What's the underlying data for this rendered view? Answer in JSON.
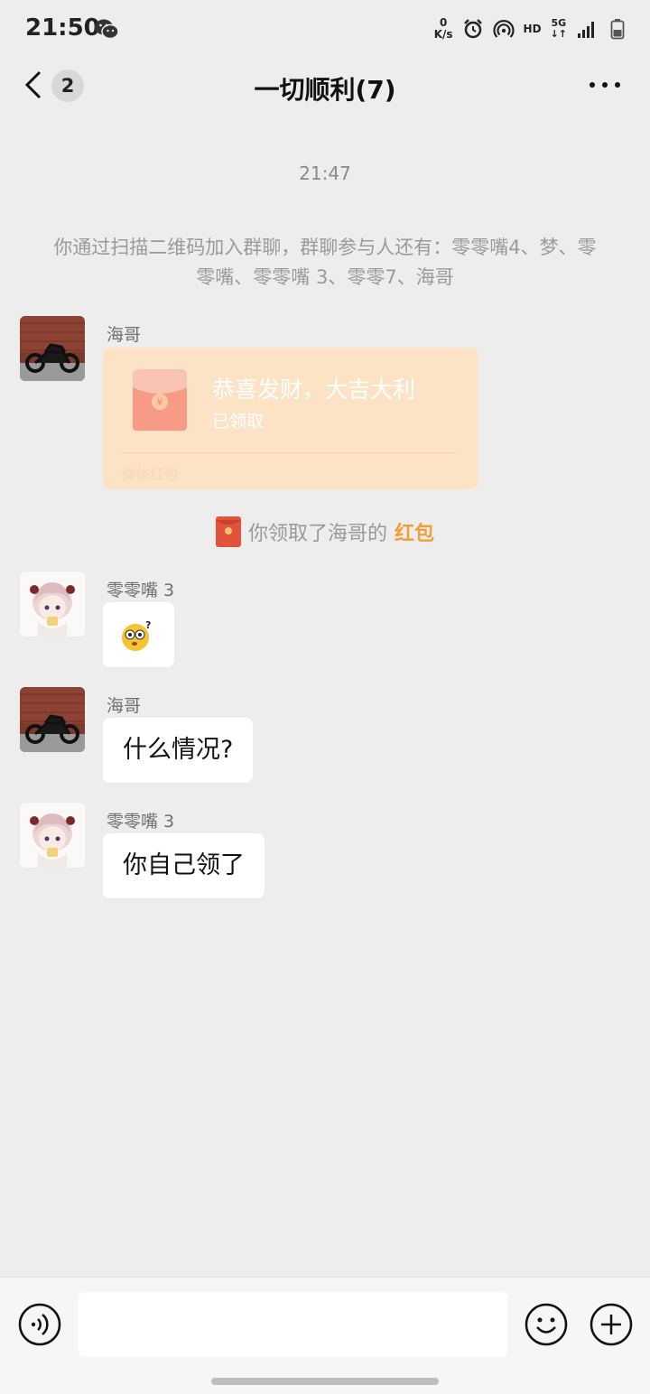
{
  "status_bar": {
    "time": "21:50",
    "net_speed_value": "0",
    "net_speed_unit": "K/s",
    "hd_label": "HD",
    "network_label": "5G",
    "network_arrows": "↓↑"
  },
  "nav": {
    "unread_count": "2",
    "title": "一切顺利(7)"
  },
  "chat": {
    "time_label": "21:47",
    "system_notice": "你通过扫描二维码加入群聊，群聊参与人还有：零零嘴4、梦、零零嘴、零零嘴 3、零零7、海哥",
    "messages": [
      {
        "sender": "海哥",
        "red_packet": {
          "title": "恭喜发财，大吉大利",
          "status": "已领取",
          "footer": "微信红包"
        }
      },
      {
        "sender": "零零嘴 3",
        "emoji": "confused-face-emoji"
      },
      {
        "sender": "海哥",
        "text": "什么情况?"
      },
      {
        "sender": "零零嘴 3",
        "text": "你自己领了"
      }
    ],
    "received_notice": {
      "text": "你领取了海哥的",
      "link": "红包"
    }
  },
  "input_bar": {
    "placeholder": ""
  },
  "colors": {
    "background": "#ededed",
    "red_packet_bg": "#fde3c5",
    "red_packet_link": "#f09f38",
    "bubble": "#ffffff"
  }
}
